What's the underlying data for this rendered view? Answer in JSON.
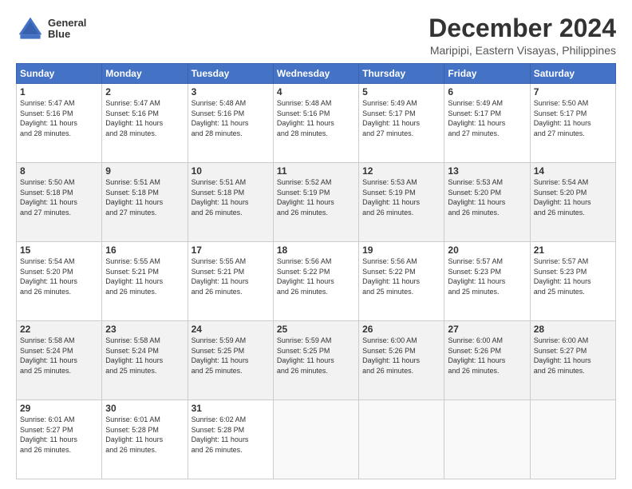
{
  "logo": {
    "line1": "General",
    "line2": "Blue"
  },
  "title": "December 2024",
  "location": "Maripipi, Eastern Visayas, Philippines",
  "days_header": [
    "Sunday",
    "Monday",
    "Tuesday",
    "Wednesday",
    "Thursday",
    "Friday",
    "Saturday"
  ],
  "weeks": [
    [
      {
        "day": "1",
        "info": "Sunrise: 5:47 AM\nSunset: 5:16 PM\nDaylight: 11 hours\nand 28 minutes."
      },
      {
        "day": "2",
        "info": "Sunrise: 5:47 AM\nSunset: 5:16 PM\nDaylight: 11 hours\nand 28 minutes."
      },
      {
        "day": "3",
        "info": "Sunrise: 5:48 AM\nSunset: 5:16 PM\nDaylight: 11 hours\nand 28 minutes."
      },
      {
        "day": "4",
        "info": "Sunrise: 5:48 AM\nSunset: 5:16 PM\nDaylight: 11 hours\nand 28 minutes."
      },
      {
        "day": "5",
        "info": "Sunrise: 5:49 AM\nSunset: 5:17 PM\nDaylight: 11 hours\nand 27 minutes."
      },
      {
        "day": "6",
        "info": "Sunrise: 5:49 AM\nSunset: 5:17 PM\nDaylight: 11 hours\nand 27 minutes."
      },
      {
        "day": "7",
        "info": "Sunrise: 5:50 AM\nSunset: 5:17 PM\nDaylight: 11 hours\nand 27 minutes."
      }
    ],
    [
      {
        "day": "8",
        "info": "Sunrise: 5:50 AM\nSunset: 5:18 PM\nDaylight: 11 hours\nand 27 minutes."
      },
      {
        "day": "9",
        "info": "Sunrise: 5:51 AM\nSunset: 5:18 PM\nDaylight: 11 hours\nand 27 minutes."
      },
      {
        "day": "10",
        "info": "Sunrise: 5:51 AM\nSunset: 5:18 PM\nDaylight: 11 hours\nand 26 minutes."
      },
      {
        "day": "11",
        "info": "Sunrise: 5:52 AM\nSunset: 5:19 PM\nDaylight: 11 hours\nand 26 minutes."
      },
      {
        "day": "12",
        "info": "Sunrise: 5:53 AM\nSunset: 5:19 PM\nDaylight: 11 hours\nand 26 minutes."
      },
      {
        "day": "13",
        "info": "Sunrise: 5:53 AM\nSunset: 5:20 PM\nDaylight: 11 hours\nand 26 minutes."
      },
      {
        "day": "14",
        "info": "Sunrise: 5:54 AM\nSunset: 5:20 PM\nDaylight: 11 hours\nand 26 minutes."
      }
    ],
    [
      {
        "day": "15",
        "info": "Sunrise: 5:54 AM\nSunset: 5:20 PM\nDaylight: 11 hours\nand 26 minutes."
      },
      {
        "day": "16",
        "info": "Sunrise: 5:55 AM\nSunset: 5:21 PM\nDaylight: 11 hours\nand 26 minutes."
      },
      {
        "day": "17",
        "info": "Sunrise: 5:55 AM\nSunset: 5:21 PM\nDaylight: 11 hours\nand 26 minutes."
      },
      {
        "day": "18",
        "info": "Sunrise: 5:56 AM\nSunset: 5:22 PM\nDaylight: 11 hours\nand 26 minutes."
      },
      {
        "day": "19",
        "info": "Sunrise: 5:56 AM\nSunset: 5:22 PM\nDaylight: 11 hours\nand 25 minutes."
      },
      {
        "day": "20",
        "info": "Sunrise: 5:57 AM\nSunset: 5:23 PM\nDaylight: 11 hours\nand 25 minutes."
      },
      {
        "day": "21",
        "info": "Sunrise: 5:57 AM\nSunset: 5:23 PM\nDaylight: 11 hours\nand 25 minutes."
      }
    ],
    [
      {
        "day": "22",
        "info": "Sunrise: 5:58 AM\nSunset: 5:24 PM\nDaylight: 11 hours\nand 25 minutes."
      },
      {
        "day": "23",
        "info": "Sunrise: 5:58 AM\nSunset: 5:24 PM\nDaylight: 11 hours\nand 25 minutes."
      },
      {
        "day": "24",
        "info": "Sunrise: 5:59 AM\nSunset: 5:25 PM\nDaylight: 11 hours\nand 25 minutes."
      },
      {
        "day": "25",
        "info": "Sunrise: 5:59 AM\nSunset: 5:25 PM\nDaylight: 11 hours\nand 26 minutes."
      },
      {
        "day": "26",
        "info": "Sunrise: 6:00 AM\nSunset: 5:26 PM\nDaylight: 11 hours\nand 26 minutes."
      },
      {
        "day": "27",
        "info": "Sunrise: 6:00 AM\nSunset: 5:26 PM\nDaylight: 11 hours\nand 26 minutes."
      },
      {
        "day": "28",
        "info": "Sunrise: 6:00 AM\nSunset: 5:27 PM\nDaylight: 11 hours\nand 26 minutes."
      }
    ],
    [
      {
        "day": "29",
        "info": "Sunrise: 6:01 AM\nSunset: 5:27 PM\nDaylight: 11 hours\nand 26 minutes."
      },
      {
        "day": "30",
        "info": "Sunrise: 6:01 AM\nSunset: 5:28 PM\nDaylight: 11 hours\nand 26 minutes."
      },
      {
        "day": "31",
        "info": "Sunrise: 6:02 AM\nSunset: 5:28 PM\nDaylight: 11 hours\nand 26 minutes."
      },
      {
        "day": "",
        "info": ""
      },
      {
        "day": "",
        "info": ""
      },
      {
        "day": "",
        "info": ""
      },
      {
        "day": "",
        "info": ""
      }
    ]
  ]
}
